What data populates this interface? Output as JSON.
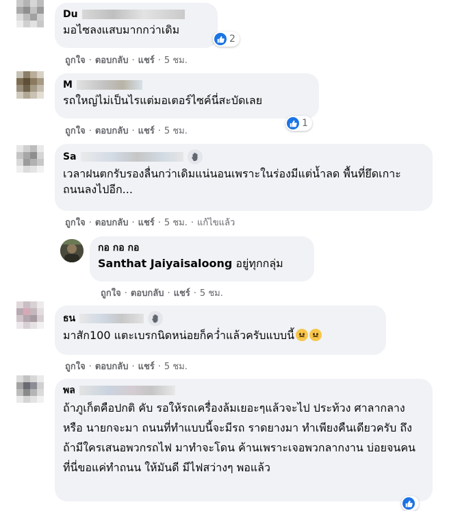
{
  "comments": [
    {
      "author": "Du",
      "text": "มอไซลงแสบมากกว่าเดิม",
      "reaction_count": "2",
      "actions": {
        "like": "ถูกใจ",
        "reply": "ตอบกลับ",
        "share": "แชร์",
        "time": "5 ชม."
      }
    },
    {
      "author": "M",
      "text": "รถใหญ่ไม่เป็นไรแต่มอเตอร์ไซค์นี่สะบัดเลย",
      "reaction_count": "1",
      "actions": {
        "like": "ถูกใจ",
        "reply": "ตอบกลับ",
        "share": "แชร์",
        "time": "5 ชม."
      }
    },
    {
      "author": "Sa",
      "text": "เวลาฝนตกรับรองลื่นกว่าเดิมแน่นอนเพราะในร่องมีแต่น้ำลด พื้นที่ยึดเกาะถนนลงไปอีก...",
      "actions": {
        "like": "ถูกใจ",
        "reply": "ตอบกลับ",
        "share": "แชร์",
        "time": "5 ชม.",
        "edited": "แก้ไขแล้ว"
      }
    },
    {
      "author": "กอ กอ กอ",
      "tag": "Santhat Jaiyaisaloong",
      "text": " อยู่ทุกกลุ่ม",
      "actions": {
        "like": "ถูกใจ",
        "reply": "ตอบกลับ",
        "share": "แชร์",
        "time": "5 ชม."
      }
    },
    {
      "author": "ธน",
      "text": "มาสัก100 แตะเบรกนิดหน่อยก็คว่ำแล้วครับแบบนี้",
      "actions": {
        "like": "ถูกใจ",
        "reply": "ตอบกลับ",
        "share": "แชร์",
        "time": "5 ชม."
      }
    },
    {
      "author": "พล",
      "text": "ถ้าภูเก็ตคือปกติ คับ รอให้รถเครื่องล้มเยอะๆแล้วจะไป ประท้วง ศาลากลาง หรือ นายกจะมา ถนนที่ทำแบบนี้จะมีรถ ราดยางมา ทำเพียงคืนเดียวครับ ถึงถ้ามีใครเสนอพวกรถไฟ มาทำจะโดน ค้านเพราะเจอพวกลากงาน บ่อยจนคนที่นี่ขอแค่ทำถนน ให้มันดี มีไฟสว่างๆ พอแล้ว"
    }
  ],
  "colors": {
    "bubble": "#f0f2f5",
    "meta": "#65676b",
    "like_blue": "#1b74e4"
  },
  "separator": "·"
}
